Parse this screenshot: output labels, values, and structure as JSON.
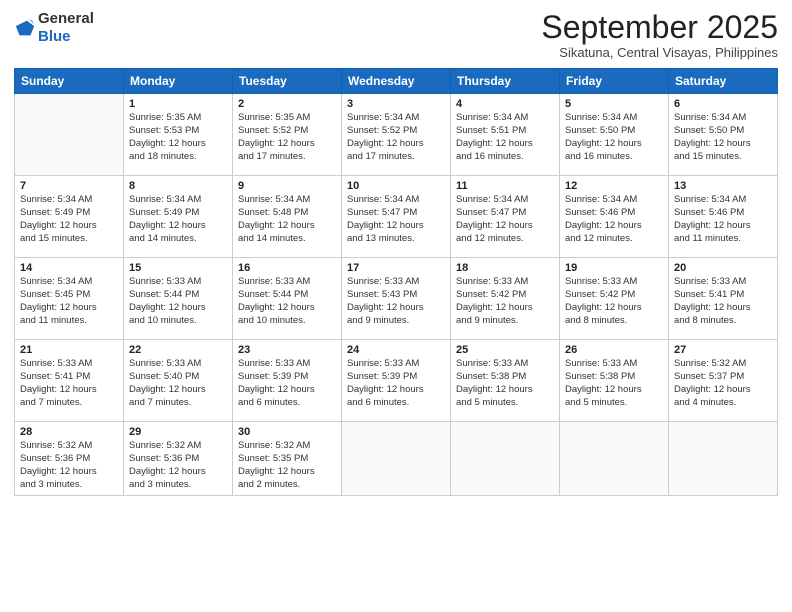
{
  "header": {
    "logo_general": "General",
    "logo_blue": "Blue",
    "month_title": "September 2025",
    "location": "Sikatuna, Central Visayas, Philippines"
  },
  "days_of_week": [
    "Sunday",
    "Monday",
    "Tuesday",
    "Wednesday",
    "Thursday",
    "Friday",
    "Saturday"
  ],
  "weeks": [
    [
      {
        "day": "",
        "info": ""
      },
      {
        "day": "1",
        "info": "Sunrise: 5:35 AM\nSunset: 5:53 PM\nDaylight: 12 hours\nand 18 minutes."
      },
      {
        "day": "2",
        "info": "Sunrise: 5:35 AM\nSunset: 5:52 PM\nDaylight: 12 hours\nand 17 minutes."
      },
      {
        "day": "3",
        "info": "Sunrise: 5:34 AM\nSunset: 5:52 PM\nDaylight: 12 hours\nand 17 minutes."
      },
      {
        "day": "4",
        "info": "Sunrise: 5:34 AM\nSunset: 5:51 PM\nDaylight: 12 hours\nand 16 minutes."
      },
      {
        "day": "5",
        "info": "Sunrise: 5:34 AM\nSunset: 5:50 PM\nDaylight: 12 hours\nand 16 minutes."
      },
      {
        "day": "6",
        "info": "Sunrise: 5:34 AM\nSunset: 5:50 PM\nDaylight: 12 hours\nand 15 minutes."
      }
    ],
    [
      {
        "day": "7",
        "info": "Sunrise: 5:34 AM\nSunset: 5:49 PM\nDaylight: 12 hours\nand 15 minutes."
      },
      {
        "day": "8",
        "info": "Sunrise: 5:34 AM\nSunset: 5:49 PM\nDaylight: 12 hours\nand 14 minutes."
      },
      {
        "day": "9",
        "info": "Sunrise: 5:34 AM\nSunset: 5:48 PM\nDaylight: 12 hours\nand 14 minutes."
      },
      {
        "day": "10",
        "info": "Sunrise: 5:34 AM\nSunset: 5:47 PM\nDaylight: 12 hours\nand 13 minutes."
      },
      {
        "day": "11",
        "info": "Sunrise: 5:34 AM\nSunset: 5:47 PM\nDaylight: 12 hours\nand 12 minutes."
      },
      {
        "day": "12",
        "info": "Sunrise: 5:34 AM\nSunset: 5:46 PM\nDaylight: 12 hours\nand 12 minutes."
      },
      {
        "day": "13",
        "info": "Sunrise: 5:34 AM\nSunset: 5:46 PM\nDaylight: 12 hours\nand 11 minutes."
      }
    ],
    [
      {
        "day": "14",
        "info": "Sunrise: 5:34 AM\nSunset: 5:45 PM\nDaylight: 12 hours\nand 11 minutes."
      },
      {
        "day": "15",
        "info": "Sunrise: 5:33 AM\nSunset: 5:44 PM\nDaylight: 12 hours\nand 10 minutes."
      },
      {
        "day": "16",
        "info": "Sunrise: 5:33 AM\nSunset: 5:44 PM\nDaylight: 12 hours\nand 10 minutes."
      },
      {
        "day": "17",
        "info": "Sunrise: 5:33 AM\nSunset: 5:43 PM\nDaylight: 12 hours\nand 9 minutes."
      },
      {
        "day": "18",
        "info": "Sunrise: 5:33 AM\nSunset: 5:42 PM\nDaylight: 12 hours\nand 9 minutes."
      },
      {
        "day": "19",
        "info": "Sunrise: 5:33 AM\nSunset: 5:42 PM\nDaylight: 12 hours\nand 8 minutes."
      },
      {
        "day": "20",
        "info": "Sunrise: 5:33 AM\nSunset: 5:41 PM\nDaylight: 12 hours\nand 8 minutes."
      }
    ],
    [
      {
        "day": "21",
        "info": "Sunrise: 5:33 AM\nSunset: 5:41 PM\nDaylight: 12 hours\nand 7 minutes."
      },
      {
        "day": "22",
        "info": "Sunrise: 5:33 AM\nSunset: 5:40 PM\nDaylight: 12 hours\nand 7 minutes."
      },
      {
        "day": "23",
        "info": "Sunrise: 5:33 AM\nSunset: 5:39 PM\nDaylight: 12 hours\nand 6 minutes."
      },
      {
        "day": "24",
        "info": "Sunrise: 5:33 AM\nSunset: 5:39 PM\nDaylight: 12 hours\nand 6 minutes."
      },
      {
        "day": "25",
        "info": "Sunrise: 5:33 AM\nSunset: 5:38 PM\nDaylight: 12 hours\nand 5 minutes."
      },
      {
        "day": "26",
        "info": "Sunrise: 5:33 AM\nSunset: 5:38 PM\nDaylight: 12 hours\nand 5 minutes."
      },
      {
        "day": "27",
        "info": "Sunrise: 5:32 AM\nSunset: 5:37 PM\nDaylight: 12 hours\nand 4 minutes."
      }
    ],
    [
      {
        "day": "28",
        "info": "Sunrise: 5:32 AM\nSunset: 5:36 PM\nDaylight: 12 hours\nand 3 minutes."
      },
      {
        "day": "29",
        "info": "Sunrise: 5:32 AM\nSunset: 5:36 PM\nDaylight: 12 hours\nand 3 minutes."
      },
      {
        "day": "30",
        "info": "Sunrise: 5:32 AM\nSunset: 5:35 PM\nDaylight: 12 hours\nand 2 minutes."
      },
      {
        "day": "",
        "info": ""
      },
      {
        "day": "",
        "info": ""
      },
      {
        "day": "",
        "info": ""
      },
      {
        "day": "",
        "info": ""
      }
    ]
  ]
}
